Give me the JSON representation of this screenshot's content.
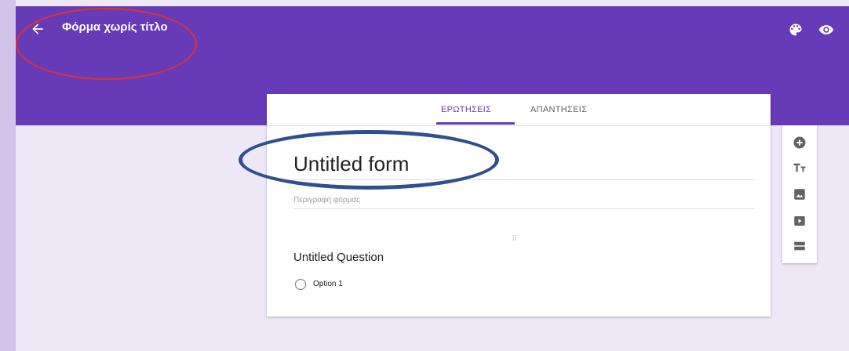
{
  "header": {
    "title": "Φόρμα χωρίς τίτλο"
  },
  "tabs": [
    {
      "label": "ΕΡΩΤΗΣΕΙΣ",
      "active": true
    },
    {
      "label": "ΑΠΑΝΤΗΣΕΙΣ",
      "active": false
    }
  ],
  "form": {
    "title": "Untitled form",
    "description_placeholder": "Περιγραφή φόρμας",
    "question": {
      "title": "Untitled Question",
      "options": [
        "Option 1"
      ]
    }
  },
  "toolbar": {
    "items": [
      "add-question-icon",
      "add-title-icon",
      "add-image-icon",
      "add-video-icon",
      "add-section-icon"
    ]
  },
  "colors": {
    "header": "#673ab7",
    "background": "#ede7f6",
    "annotation_red": "#e0322b",
    "annotation_blue": "#2f4f8f"
  }
}
